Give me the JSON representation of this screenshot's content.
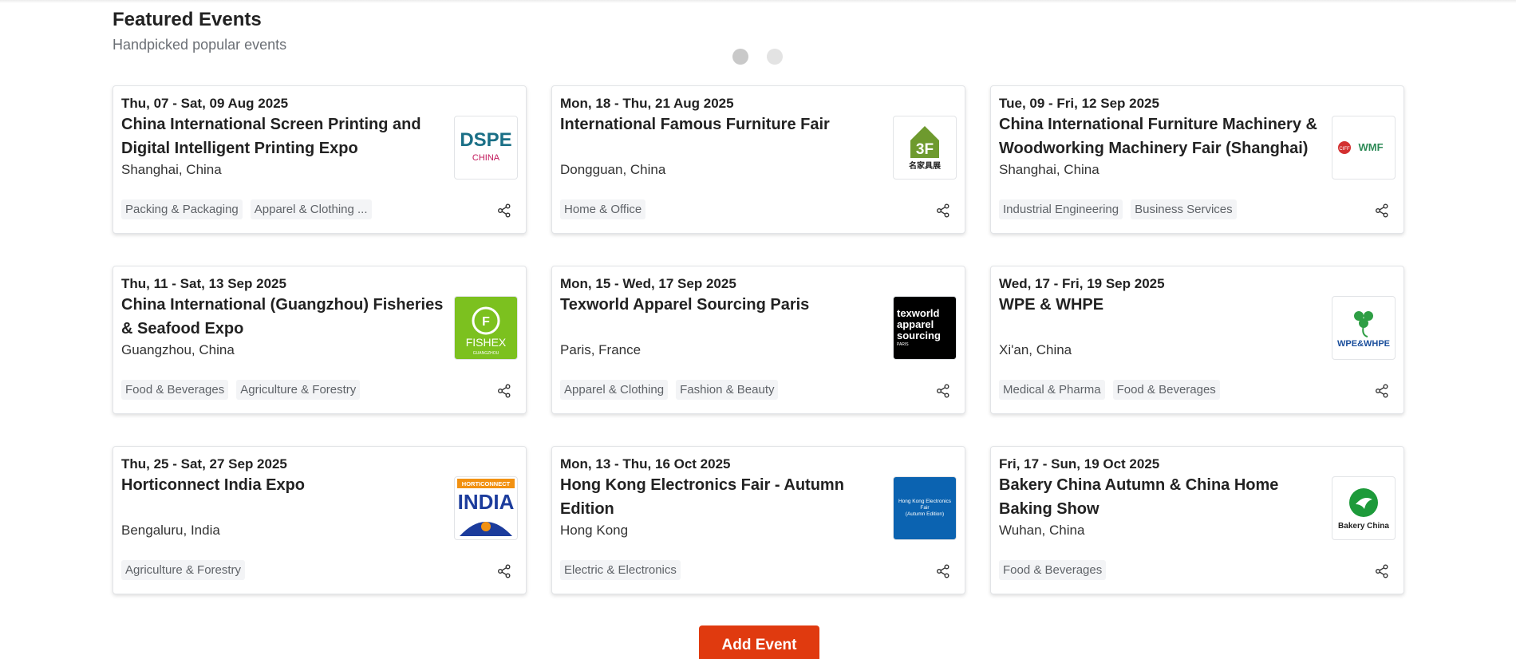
{
  "section": {
    "title": "Featured Events",
    "subtitle": "Handpicked popular events"
  },
  "carousel": {
    "pages": 2,
    "active": 1
  },
  "events": [
    {
      "date": "Thu, 07 - Sat, 09 Aug 2025",
      "title": "China International Screen Printing and Digital Intelligent Printing Expo",
      "location": "Shanghai, China",
      "tags": [
        "Packing & Packaging",
        "Apparel & Clothing ..."
      ],
      "logo": {
        "text": "DSPE",
        "sub": "CHINA"
      }
    },
    {
      "date": "Mon, 18 - Thu, 21 Aug 2025",
      "title": "International Famous Furniture Fair",
      "location": "Dongguan, China",
      "tags": [
        "Home & Office"
      ],
      "logo": {
        "text": "3F",
        "sub": "名家具展"
      }
    },
    {
      "date": "Tue, 09 - Fri, 12 Sep 2025",
      "title": "China International Furniture Machinery & Woodworking Machinery Fair (Shanghai)",
      "location": "Shanghai, China",
      "tags": [
        "Industrial Engineering",
        "Business Services"
      ],
      "logo": {
        "text": "WMF",
        "sub": "CIFF"
      }
    },
    {
      "date": "Thu, 11 - Sat, 13 Sep 2025",
      "title": "China International (Guangzhou) Fisheries & Seafood Expo",
      "location": "Guangzhou, China",
      "tags": [
        "Food & Beverages",
        "Agriculture & Forestry"
      ],
      "logo": {
        "text": "FISHEX",
        "sub": "GUANGZHOU"
      }
    },
    {
      "date": "Mon, 15 - Wed, 17 Sep 2025",
      "title": "Texworld Apparel Sourcing Paris",
      "location": "Paris, France",
      "tags": [
        "Apparel & Clothing",
        "Fashion & Beauty"
      ],
      "logo": {
        "text": "texworld apparel sourcing",
        "sub": "PARIS"
      }
    },
    {
      "date": "Wed, 17 - Fri, 19 Sep 2025",
      "title": "WPE & WHPE",
      "location": "Xi'an, China",
      "tags": [
        "Medical & Pharma",
        "Food & Beverages"
      ],
      "logo": {
        "text": "WPE&WHPE",
        "sub": ""
      }
    },
    {
      "date": "Thu, 25 - Sat, 27 Sep 2025",
      "title": "Horticonnect India Expo",
      "location": "Bengaluru, India",
      "tags": [
        "Agriculture & Forestry"
      ],
      "logo": {
        "text": "INDIA",
        "sub": "HORTICONNECT"
      }
    },
    {
      "date": "Mon, 13 - Thu, 16 Oct 2025",
      "title": "Hong Kong Electronics Fair - Autumn Edition",
      "location": "Hong Kong",
      "tags": [
        "Electric & Electronics"
      ],
      "logo": {
        "text": "Hong Kong Electronics Fair",
        "sub": "(Autumn Edition)"
      }
    },
    {
      "date": "Fri, 17 - Sun, 19 Oct 2025",
      "title": "Bakery China Autumn & China Home Baking Show",
      "location": "Wuhan, China",
      "tags": [
        "Food & Beverages"
      ],
      "logo": {
        "text": "Bakery China",
        "sub": ""
      }
    }
  ],
  "actions": {
    "add_event": "Add Event"
  },
  "colors": {
    "accent": "#e03a0f",
    "tag_bg": "#f3f4f6"
  }
}
